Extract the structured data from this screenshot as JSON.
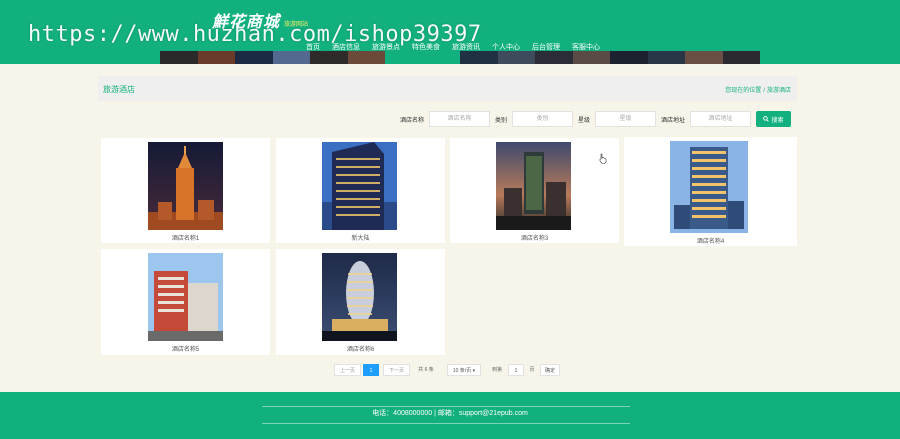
{
  "header": {
    "logo": "鮮花商城",
    "logo_sub": "旅游网站",
    "nav": [
      "首页",
      "酒店信息",
      "旅游景点",
      "特色美食",
      "旅游资讯",
      "个人中心",
      "后台管理",
      "客服中心"
    ]
  },
  "watermark": "https://www.huzhan.com/ishop39397",
  "breadcrumb": {
    "title": "旅游酒店",
    "location_label": "您现在的位置",
    "separator": "/",
    "current": "旅游酒店"
  },
  "search": {
    "fields": [
      {
        "label": "酒店名称",
        "placeholder": "酒店名称"
      },
      {
        "label": "类别",
        "placeholder": "类别"
      },
      {
        "label": "星级",
        "placeholder": "星级"
      },
      {
        "label": "酒店地址",
        "placeholder": "酒店地址"
      }
    ],
    "button_label": "搜索"
  },
  "hotels": [
    {
      "name": "酒店名称1"
    },
    {
      "name": "新大陆"
    },
    {
      "name": "酒店名称3"
    },
    {
      "name": "酒店名称4"
    },
    {
      "name": "酒店名称5"
    },
    {
      "name": "酒店名称6"
    }
  ],
  "pagination": {
    "prev": "上一页",
    "current_page": "1",
    "next": "下一页",
    "total": "共 6 条",
    "page_size": "10 条/页",
    "goto_label": "到第",
    "goto_value": "1",
    "page_unit": "页",
    "confirm": "确定"
  },
  "footer": {
    "text": "电话：4008000000 | 邮箱：support@21epub.com"
  },
  "colors": {
    "primary": "#12b07e",
    "page_bg": "#f7f4e9",
    "active_page": "#1e9fff"
  }
}
